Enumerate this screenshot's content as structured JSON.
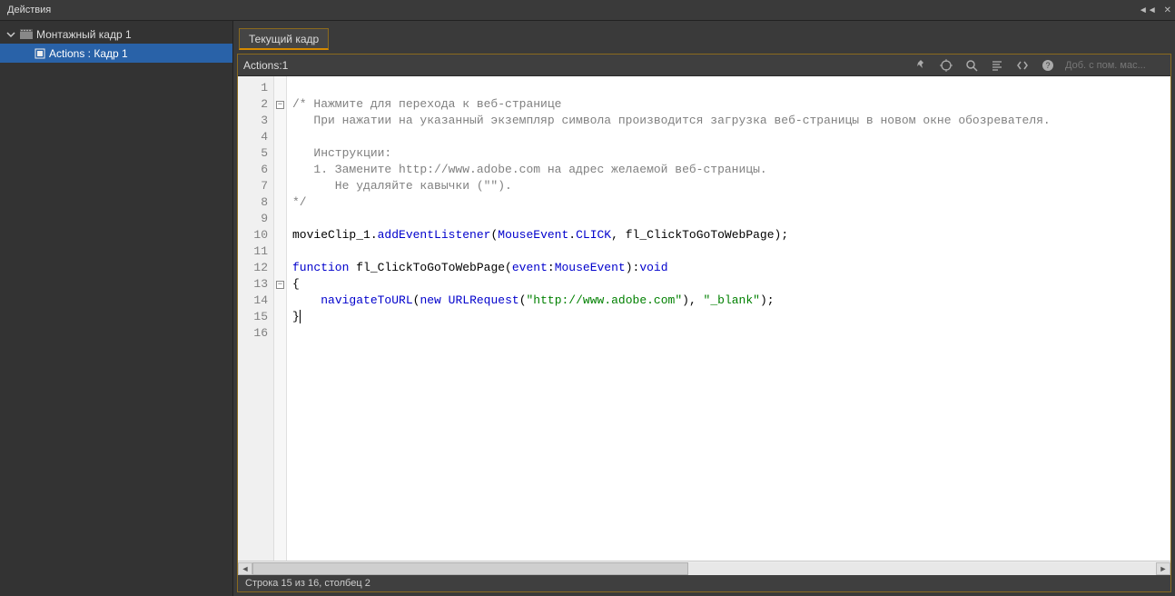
{
  "panel": {
    "title": "Действия"
  },
  "tree": {
    "scene": "Монтажный кадр 1",
    "frame": "Actions : Кадр 1"
  },
  "tab": {
    "label": "Текущий кадр"
  },
  "editor": {
    "path": "Actions:1",
    "search_placeholder": "Доб. с пом. мас..."
  },
  "code": {
    "lines": [
      {
        "n": 1,
        "segs": []
      },
      {
        "n": 2,
        "segs": [
          {
            "c": "c-comment",
            "t": "/* Нажмите для перехода к веб-странице"
          }
        ],
        "fold": "-"
      },
      {
        "n": 3,
        "segs": [
          {
            "c": "c-comment",
            "t": "   При нажатии на указанный экземпляр символа производится загрузка веб-страницы в новом окне обозревателя."
          }
        ]
      },
      {
        "n": 4,
        "segs": []
      },
      {
        "n": 5,
        "segs": [
          {
            "c": "c-comment",
            "t": "   Инструкции:"
          }
        ]
      },
      {
        "n": 6,
        "segs": [
          {
            "c": "c-comment",
            "t": "   1. Замените http://www.adobe.com на адрес желаемой веб-страницы."
          }
        ]
      },
      {
        "n": 7,
        "segs": [
          {
            "c": "c-comment",
            "t": "      Не удаляйте кавычки (\"\")."
          }
        ]
      },
      {
        "n": 8,
        "segs": [
          {
            "c": "c-comment",
            "t": "*/"
          }
        ]
      },
      {
        "n": 9,
        "segs": []
      },
      {
        "n": 10,
        "segs": [
          {
            "c": "c-ident",
            "t": "movieClip_1."
          },
          {
            "c": "c-method",
            "t": "addEventListener"
          },
          {
            "c": "c-ident",
            "t": "("
          },
          {
            "c": "c-type",
            "t": "MouseEvent"
          },
          {
            "c": "c-ident",
            "t": "."
          },
          {
            "c": "c-type",
            "t": "CLICK"
          },
          {
            "c": "c-ident",
            "t": ", fl_ClickToGoToWebPage);"
          }
        ]
      },
      {
        "n": 11,
        "segs": []
      },
      {
        "n": 12,
        "segs": [
          {
            "c": "c-keyword",
            "t": "function"
          },
          {
            "c": "c-ident",
            "t": " fl_ClickToGoToWebPage("
          },
          {
            "c": "c-keyword",
            "t": "event"
          },
          {
            "c": "c-ident",
            "t": ":"
          },
          {
            "c": "c-type",
            "t": "MouseEvent"
          },
          {
            "c": "c-ident",
            "t": "):"
          },
          {
            "c": "c-keyword",
            "t": "void"
          }
        ]
      },
      {
        "n": 13,
        "segs": [
          {
            "c": "c-ident",
            "t": "{"
          }
        ],
        "fold": "-"
      },
      {
        "n": 14,
        "segs": [
          {
            "c": "c-ident",
            "t": "    "
          },
          {
            "c": "c-method",
            "t": "navigateToURL"
          },
          {
            "c": "c-ident",
            "t": "("
          },
          {
            "c": "c-keyword",
            "t": "new"
          },
          {
            "c": "c-ident",
            "t": " "
          },
          {
            "c": "c-type",
            "t": "URLRequest"
          },
          {
            "c": "c-ident",
            "t": "("
          },
          {
            "c": "c-string",
            "t": "\"http://www.adobe.com\""
          },
          {
            "c": "c-ident",
            "t": "), "
          },
          {
            "c": "c-string",
            "t": "\"_blank\""
          },
          {
            "c": "c-ident",
            "t": ");"
          }
        ]
      },
      {
        "n": 15,
        "segs": [
          {
            "c": "c-ident",
            "t": "}"
          }
        ],
        "cursor": true
      },
      {
        "n": 16,
        "segs": []
      }
    ]
  },
  "status": {
    "text": "Строка 15 из 16, столбец 2"
  }
}
